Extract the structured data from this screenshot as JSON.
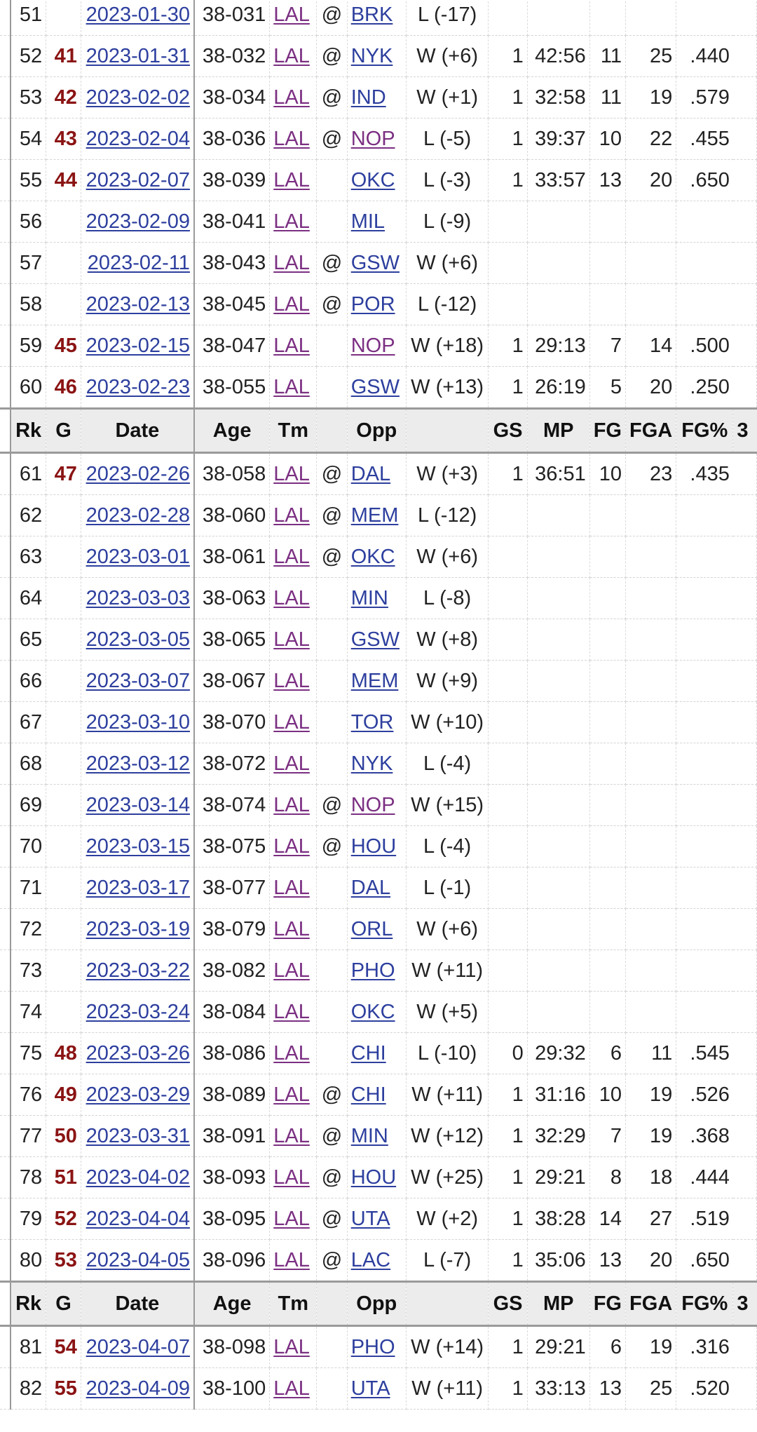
{
  "header": {
    "rk": "Rk",
    "g": "G",
    "date": "Date",
    "age": "Age",
    "tm": "Tm",
    "loc": "",
    "opp": "Opp",
    "res": "",
    "gs": "GS",
    "mp": "MP",
    "fg": "FG",
    "fga": "FGA",
    "fgp": "FG%",
    "more": "3"
  },
  "rows": [
    {
      "type": "game",
      "rk": "51",
      "g": "",
      "date": "2023-01-30",
      "age": "38-031",
      "tm": "LAL",
      "loc": "@",
      "opp": "BRK",
      "res": "L (-17)",
      "gs": "",
      "mp": "",
      "fg": "",
      "fga": "",
      "fgp": "",
      "visited": false
    },
    {
      "type": "game",
      "rk": "52",
      "g": "41",
      "date": "2023-01-31",
      "age": "38-032",
      "tm": "LAL",
      "loc": "@",
      "opp": "NYK",
      "res": "W (+6)",
      "gs": "1",
      "mp": "42:56",
      "fg": "11",
      "fga": "25",
      "fgp": ".440",
      "visited": false
    },
    {
      "type": "game",
      "rk": "53",
      "g": "42",
      "date": "2023-02-02",
      "age": "38-034",
      "tm": "LAL",
      "loc": "@",
      "opp": "IND",
      "res": "W (+1)",
      "gs": "1",
      "mp": "32:58",
      "fg": "11",
      "fga": "19",
      "fgp": ".579",
      "visited": false
    },
    {
      "type": "game",
      "rk": "54",
      "g": "43",
      "date": "2023-02-04",
      "age": "38-036",
      "tm": "LAL",
      "loc": "@",
      "opp": "NOP",
      "res": "L (-5)",
      "gs": "1",
      "mp": "39:37",
      "fg": "10",
      "fga": "22",
      "fgp": ".455",
      "visited": true
    },
    {
      "type": "game",
      "rk": "55",
      "g": "44",
      "date": "2023-02-07",
      "age": "38-039",
      "tm": "LAL",
      "loc": "",
      "opp": "OKC",
      "res": "L (-3)",
      "gs": "1",
      "mp": "33:57",
      "fg": "13",
      "fga": "20",
      "fgp": ".650",
      "visited": false
    },
    {
      "type": "game",
      "rk": "56",
      "g": "",
      "date": "2023-02-09",
      "age": "38-041",
      "tm": "LAL",
      "loc": "",
      "opp": "MIL",
      "res": "L (-9)",
      "gs": "",
      "mp": "",
      "fg": "",
      "fga": "",
      "fgp": "",
      "visited": false
    },
    {
      "type": "game",
      "rk": "57",
      "g": "",
      "date": "2023-02-11",
      "age": "38-043",
      "tm": "LAL",
      "loc": "@",
      "opp": "GSW",
      "res": "W (+6)",
      "gs": "",
      "mp": "",
      "fg": "",
      "fga": "",
      "fgp": "",
      "visited": false
    },
    {
      "type": "game",
      "rk": "58",
      "g": "",
      "date": "2023-02-13",
      "age": "38-045",
      "tm": "LAL",
      "loc": "@",
      "opp": "POR",
      "res": "L (-12)",
      "gs": "",
      "mp": "",
      "fg": "",
      "fga": "",
      "fgp": "",
      "visited": false
    },
    {
      "type": "game",
      "rk": "59",
      "g": "45",
      "date": "2023-02-15",
      "age": "38-047",
      "tm": "LAL",
      "loc": "",
      "opp": "NOP",
      "res": "W (+18)",
      "gs": "1",
      "mp": "29:13",
      "fg": "7",
      "fga": "14",
      "fgp": ".500",
      "visited": true
    },
    {
      "type": "game",
      "rk": "60",
      "g": "46",
      "date": "2023-02-23",
      "age": "38-055",
      "tm": "LAL",
      "loc": "",
      "opp": "GSW",
      "res": "W (+13)",
      "gs": "1",
      "mp": "26:19",
      "fg": "5",
      "fga": "20",
      "fgp": ".250",
      "visited": false
    },
    {
      "type": "header"
    },
    {
      "type": "game",
      "rk": "61",
      "g": "47",
      "date": "2023-02-26",
      "age": "38-058",
      "tm": "LAL",
      "loc": "@",
      "opp": "DAL",
      "res": "W (+3)",
      "gs": "1",
      "mp": "36:51",
      "fg": "10",
      "fga": "23",
      "fgp": ".435",
      "visited": false
    },
    {
      "type": "game",
      "rk": "62",
      "g": "",
      "date": "2023-02-28",
      "age": "38-060",
      "tm": "LAL",
      "loc": "@",
      "opp": "MEM",
      "res": "L (-12)",
      "gs": "",
      "mp": "",
      "fg": "",
      "fga": "",
      "fgp": "",
      "visited": false
    },
    {
      "type": "game",
      "rk": "63",
      "g": "",
      "date": "2023-03-01",
      "age": "38-061",
      "tm": "LAL",
      "loc": "@",
      "opp": "OKC",
      "res": "W (+6)",
      "gs": "",
      "mp": "",
      "fg": "",
      "fga": "",
      "fgp": "",
      "visited": false
    },
    {
      "type": "game",
      "rk": "64",
      "g": "",
      "date": "2023-03-03",
      "age": "38-063",
      "tm": "LAL",
      "loc": "",
      "opp": "MIN",
      "res": "L (-8)",
      "gs": "",
      "mp": "",
      "fg": "",
      "fga": "",
      "fgp": "",
      "visited": false
    },
    {
      "type": "game",
      "rk": "65",
      "g": "",
      "date": "2023-03-05",
      "age": "38-065",
      "tm": "LAL",
      "loc": "",
      "opp": "GSW",
      "res": "W (+8)",
      "gs": "",
      "mp": "",
      "fg": "",
      "fga": "",
      "fgp": "",
      "visited": false
    },
    {
      "type": "game",
      "rk": "66",
      "g": "",
      "date": "2023-03-07",
      "age": "38-067",
      "tm": "LAL",
      "loc": "",
      "opp": "MEM",
      "res": "W (+9)",
      "gs": "",
      "mp": "",
      "fg": "",
      "fga": "",
      "fgp": "",
      "visited": false
    },
    {
      "type": "game",
      "rk": "67",
      "g": "",
      "date": "2023-03-10",
      "age": "38-070",
      "tm": "LAL",
      "loc": "",
      "opp": "TOR",
      "res": "W (+10)",
      "gs": "",
      "mp": "",
      "fg": "",
      "fga": "",
      "fgp": "",
      "visited": false
    },
    {
      "type": "game",
      "rk": "68",
      "g": "",
      "date": "2023-03-12",
      "age": "38-072",
      "tm": "LAL",
      "loc": "",
      "opp": "NYK",
      "res": "L (-4)",
      "gs": "",
      "mp": "",
      "fg": "",
      "fga": "",
      "fgp": "",
      "visited": false
    },
    {
      "type": "game",
      "rk": "69",
      "g": "",
      "date": "2023-03-14",
      "age": "38-074",
      "tm": "LAL",
      "loc": "@",
      "opp": "NOP",
      "res": "W (+15)",
      "gs": "",
      "mp": "",
      "fg": "",
      "fga": "",
      "fgp": "",
      "visited": true
    },
    {
      "type": "game",
      "rk": "70",
      "g": "",
      "date": "2023-03-15",
      "age": "38-075",
      "tm": "LAL",
      "loc": "@",
      "opp": "HOU",
      "res": "L (-4)",
      "gs": "",
      "mp": "",
      "fg": "",
      "fga": "",
      "fgp": "",
      "visited": false
    },
    {
      "type": "game",
      "rk": "71",
      "g": "",
      "date": "2023-03-17",
      "age": "38-077",
      "tm": "LAL",
      "loc": "",
      "opp": "DAL",
      "res": "L (-1)",
      "gs": "",
      "mp": "",
      "fg": "",
      "fga": "",
      "fgp": "",
      "visited": false
    },
    {
      "type": "game",
      "rk": "72",
      "g": "",
      "date": "2023-03-19",
      "age": "38-079",
      "tm": "LAL",
      "loc": "",
      "opp": "ORL",
      "res": "W (+6)",
      "gs": "",
      "mp": "",
      "fg": "",
      "fga": "",
      "fgp": "",
      "visited": false
    },
    {
      "type": "game",
      "rk": "73",
      "g": "",
      "date": "2023-03-22",
      "age": "38-082",
      "tm": "LAL",
      "loc": "",
      "opp": "PHO",
      "res": "W (+11)",
      "gs": "",
      "mp": "",
      "fg": "",
      "fga": "",
      "fgp": "",
      "visited": false
    },
    {
      "type": "game",
      "rk": "74",
      "g": "",
      "date": "2023-03-24",
      "age": "38-084",
      "tm": "LAL",
      "loc": "",
      "opp": "OKC",
      "res": "W (+5)",
      "gs": "",
      "mp": "",
      "fg": "",
      "fga": "",
      "fgp": "",
      "visited": false
    },
    {
      "type": "game",
      "rk": "75",
      "g": "48",
      "date": "2023-03-26",
      "age": "38-086",
      "tm": "LAL",
      "loc": "",
      "opp": "CHI",
      "res": "L (-10)",
      "gs": "0",
      "mp": "29:32",
      "fg": "6",
      "fga": "11",
      "fgp": ".545",
      "visited": false
    },
    {
      "type": "game",
      "rk": "76",
      "g": "49",
      "date": "2023-03-29",
      "age": "38-089",
      "tm": "LAL",
      "loc": "@",
      "opp": "CHI",
      "res": "W (+11)",
      "gs": "1",
      "mp": "31:16",
      "fg": "10",
      "fga": "19",
      "fgp": ".526",
      "visited": false
    },
    {
      "type": "game",
      "rk": "77",
      "g": "50",
      "date": "2023-03-31",
      "age": "38-091",
      "tm": "LAL",
      "loc": "@",
      "opp": "MIN",
      "res": "W (+12)",
      "gs": "1",
      "mp": "32:29",
      "fg": "7",
      "fga": "19",
      "fgp": ".368",
      "visited": false
    },
    {
      "type": "game",
      "rk": "78",
      "g": "51",
      "date": "2023-04-02",
      "age": "38-093",
      "tm": "LAL",
      "loc": "@",
      "opp": "HOU",
      "res": "W (+25)",
      "gs": "1",
      "mp": "29:21",
      "fg": "8",
      "fga": "18",
      "fgp": ".444",
      "visited": false
    },
    {
      "type": "game",
      "rk": "79",
      "g": "52",
      "date": "2023-04-04",
      "age": "38-095",
      "tm": "LAL",
      "loc": "@",
      "opp": "UTA",
      "res": "W (+2)",
      "gs": "1",
      "mp": "38:28",
      "fg": "14",
      "fga": "27",
      "fgp": ".519",
      "visited": false
    },
    {
      "type": "game",
      "rk": "80",
      "g": "53",
      "date": "2023-04-05",
      "age": "38-096",
      "tm": "LAL",
      "loc": "@",
      "opp": "LAC",
      "res": "L (-7)",
      "gs": "1",
      "mp": "35:06",
      "fg": "13",
      "fga": "20",
      "fgp": ".650",
      "visited": false
    },
    {
      "type": "header"
    },
    {
      "type": "game",
      "rk": "81",
      "g": "54",
      "date": "2023-04-07",
      "age": "38-098",
      "tm": "LAL",
      "loc": "",
      "opp": "PHO",
      "res": "W (+14)",
      "gs": "1",
      "mp": "29:21",
      "fg": "6",
      "fga": "19",
      "fgp": ".316",
      "visited": false
    },
    {
      "type": "game",
      "rk": "82",
      "g": "55",
      "date": "2023-04-09",
      "age": "38-100",
      "tm": "LAL",
      "loc": "",
      "opp": "UTA",
      "res": "W (+11)",
      "gs": "1",
      "mp": "33:13",
      "fg": "13",
      "fga": "25",
      "fgp": ".520",
      "visited": false
    }
  ],
  "colors": {
    "link": "#2d3f9e",
    "visited_link": "#7b2f82",
    "game_number": "#8b1414",
    "header_bg": "#ececec",
    "border": "#9a9a9a"
  }
}
